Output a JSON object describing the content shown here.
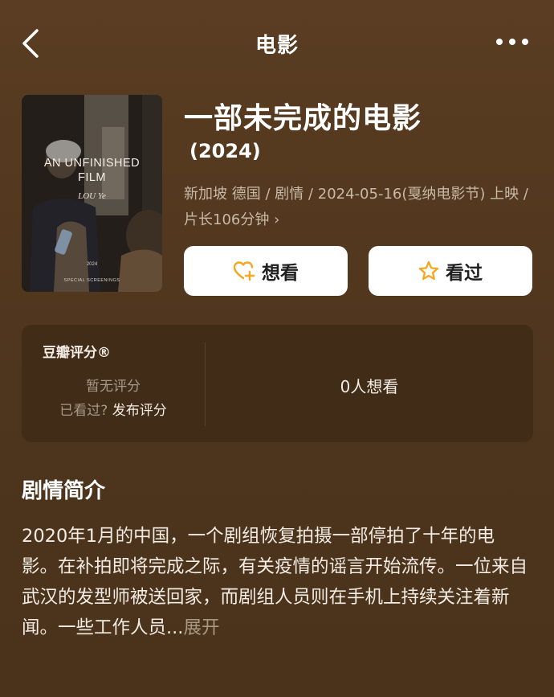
{
  "header": {
    "title": "电影"
  },
  "poster": {
    "title_line1": "AN UNFINISHED",
    "title_line2": "FILM",
    "author": "LOU Ye",
    "year": "2024",
    "footer": "SPECIAL SCREENINGS"
  },
  "movie": {
    "title": "一部未完成的电影",
    "year": "(2024)",
    "meta": "新加坡 德国 / 剧情 / 2024-05-16(戛纳电影节) 上映 / 片长106分钟",
    "meta_chevron": "›"
  },
  "actions": {
    "want_label": "想看",
    "seen_label": "看过"
  },
  "rating": {
    "title": "豆瓣评分®",
    "no_rating": "暂无评分",
    "seen_prompt": "已看过?",
    "publish_label": "发布评分",
    "want_count": "0人想看"
  },
  "synopsis": {
    "heading": "剧情简介",
    "text": "2020年1月的中国，一个剧组恢复拍摄一部停拍了十年的电影。在补拍即将完成之际，有关疫情的谣言开始流传。一位来自武汉的发型师被送回家，而剧组人员则在手机上持续关注着新闻。一些工作人员...",
    "expand_label": "展开"
  },
  "colors": {
    "background": "#57391f",
    "card": "#412c17",
    "accent": "#f5a623",
    "muted_text": "#a89985"
  },
  "icons": {
    "back": "chevron-left-icon",
    "more": "more-dots-icon",
    "want": "heart-plus-icon",
    "seen": "star-icon"
  }
}
